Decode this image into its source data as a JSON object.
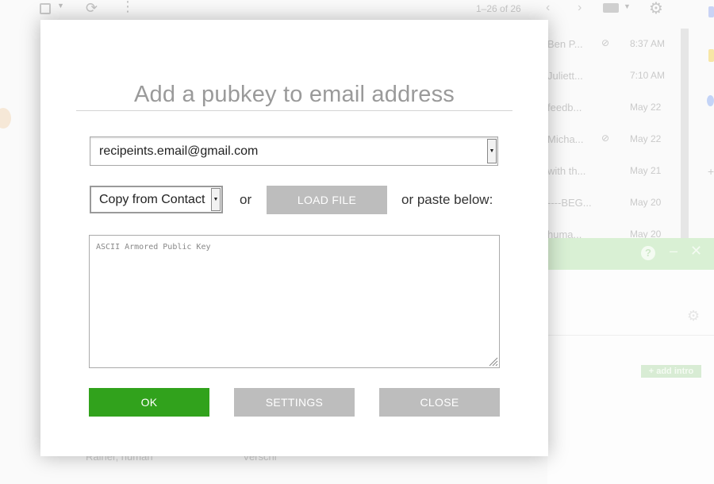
{
  "background": {
    "pager_text": "1–26 of 26",
    "emails": [
      {
        "snippet": "Ben P...",
        "has_attachment": true,
        "time": "8:37 AM"
      },
      {
        "snippet": "Juliett...",
        "has_attachment": false,
        "time": "7:10 AM"
      },
      {
        "snippet": "feedb...",
        "has_attachment": false,
        "time": "May 22"
      },
      {
        "snippet": "Micha...",
        "has_attachment": true,
        "time": "May 22"
      },
      {
        "snippet": "with th...",
        "has_attachment": false,
        "time": "May 21"
      },
      {
        "snippet": "----BEG...",
        "has_attachment": false,
        "time": "May 20"
      },
      {
        "snippet": "huma...",
        "has_attachment": false,
        "time": "May 20"
      }
    ],
    "add_intro_label": "+ add intro",
    "footer_name": "Rainer, human",
    "footer_preview": "Verschl"
  },
  "dialog": {
    "title": "Add a pubkey to email address",
    "email_select": {
      "selected": "recipeints.email@gmail.com"
    },
    "contact_select": {
      "selected": "Copy from Contact"
    },
    "or_label": "or",
    "load_file_label": "LOAD FILE",
    "paste_label": "or paste below:",
    "key_textarea": {
      "placeholder": "ASCII Armored Public Key",
      "value": ""
    },
    "ok_label": "OK",
    "settings_label": "SETTINGS",
    "close_label": "CLOSE"
  },
  "colors": {
    "ok_button": "#31a21c",
    "secondary_button": "#bdbdbd",
    "title_text": "#9a9a9a"
  }
}
